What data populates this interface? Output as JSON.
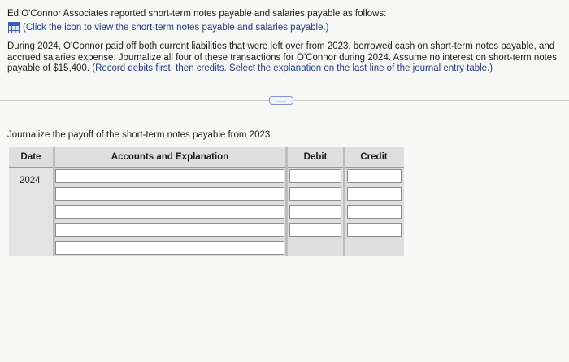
{
  "intro": {
    "text": "Ed O'Connor Associates reported short-term notes payable and salaries payable as follows:",
    "data_link": "(Click the icon to view the short-term notes payable and salaries payable.)",
    "link_icon": "data-table-icon"
  },
  "body": {
    "text": "During 2024, O'Connor paid off both current liabilities that were left over from 2023, borrowed cash on short-term notes payable, and accrued salaries expense. Journalize all four of these transactions for O'Connor during 2024. Assume no interest on short-term notes payable of $15,400.",
    "instruction_note": "(Record debits first, then credits. Select the explanation on the last line of the journal entry table.)"
  },
  "more_button": {
    "label": "....."
  },
  "task": {
    "instruction": "Journalize the payoff of the short-term notes payable from 2023."
  },
  "journal": {
    "headers": {
      "date": "Date",
      "accounts": "Accounts and Explanation",
      "debit": "Debit",
      "credit": "Credit"
    },
    "date_value": "2024",
    "rows": [
      {
        "account": "",
        "debit": "",
        "credit": ""
      },
      {
        "account": "",
        "debit": "",
        "credit": ""
      },
      {
        "account": "",
        "debit": "",
        "credit": ""
      },
      {
        "account": "",
        "debit": "",
        "credit": ""
      },
      {
        "account": ""
      }
    ]
  },
  "colors": {
    "link": "#1b3d8f",
    "table_bg": "#dedede",
    "page_bg": "#f7f7f5"
  }
}
